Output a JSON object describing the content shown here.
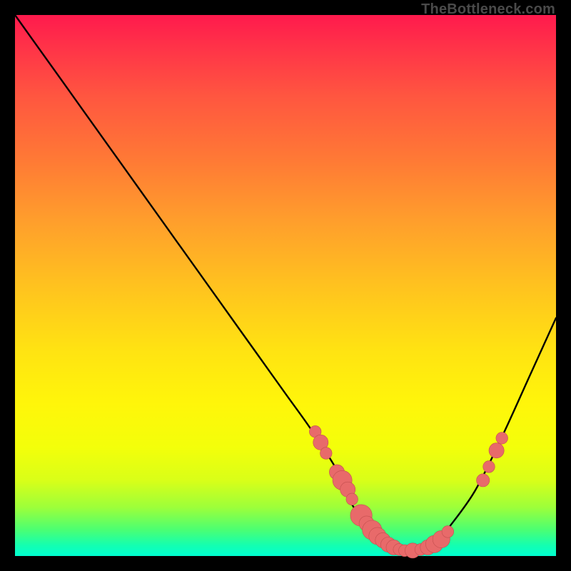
{
  "watermark": "TheBottleneck.com",
  "colors": {
    "background": "#000000",
    "curve": "#000000",
    "marker_fill": "#e86a6a",
    "marker_stroke": "#c34f4f"
  },
  "chart_data": {
    "type": "line",
    "title": "",
    "xlabel": "",
    "ylabel": "",
    "xlim": [
      0,
      100
    ],
    "ylim": [
      0,
      100
    ],
    "grid": false,
    "legend": false,
    "note": "Bottleneck-style V curve; values are percent of plot width (x) and height (y) estimated from pixels.",
    "x": [
      0,
      5,
      10,
      15,
      20,
      25,
      30,
      35,
      40,
      45,
      50,
      55,
      60,
      62,
      65,
      68,
      70,
      72,
      75,
      78,
      80,
      85,
      90,
      95,
      100
    ],
    "y": [
      100,
      93,
      86,
      79,
      72,
      65,
      58,
      51,
      44,
      37,
      30,
      23,
      15,
      10,
      6,
      3,
      1.5,
      1,
      1.2,
      2.5,
      5,
      12,
      22,
      33,
      44
    ],
    "markers": [
      {
        "x": 55.5,
        "y": 23.0,
        "r": 1.1
      },
      {
        "x": 56.5,
        "y": 21.0,
        "r": 1.4
      },
      {
        "x": 57.5,
        "y": 19.0,
        "r": 1.1
      },
      {
        "x": 59.5,
        "y": 15.5,
        "r": 1.4
      },
      {
        "x": 60.5,
        "y": 14.0,
        "r": 1.8
      },
      {
        "x": 61.5,
        "y": 12.3,
        "r": 1.4
      },
      {
        "x": 62.3,
        "y": 10.5,
        "r": 1.1
      },
      {
        "x": 64.0,
        "y": 7.5,
        "r": 2.0
      },
      {
        "x": 65.0,
        "y": 6.0,
        "r": 1.4
      },
      {
        "x": 66.0,
        "y": 4.8,
        "r": 1.8
      },
      {
        "x": 67.0,
        "y": 3.7,
        "r": 1.6
      },
      {
        "x": 68.0,
        "y": 2.9,
        "r": 1.4
      },
      {
        "x": 69.0,
        "y": 2.1,
        "r": 1.4
      },
      {
        "x": 70.0,
        "y": 1.6,
        "r": 1.4
      },
      {
        "x": 71.0,
        "y": 1.2,
        "r": 1.1
      },
      {
        "x": 72.0,
        "y": 1.0,
        "r": 1.1
      },
      {
        "x": 73.5,
        "y": 1.0,
        "r": 1.4
      },
      {
        "x": 75.0,
        "y": 1.2,
        "r": 1.1
      },
      {
        "x": 76.3,
        "y": 1.6,
        "r": 1.4
      },
      {
        "x": 77.5,
        "y": 2.2,
        "r": 1.6
      },
      {
        "x": 78.8,
        "y": 3.1,
        "r": 1.6
      },
      {
        "x": 80.0,
        "y": 4.5,
        "r": 1.1
      },
      {
        "x": 86.5,
        "y": 14.0,
        "r": 1.2
      },
      {
        "x": 87.6,
        "y": 16.5,
        "r": 1.1
      },
      {
        "x": 89.0,
        "y": 19.5,
        "r": 1.4
      },
      {
        "x": 90.0,
        "y": 21.8,
        "r": 1.1
      }
    ]
  }
}
